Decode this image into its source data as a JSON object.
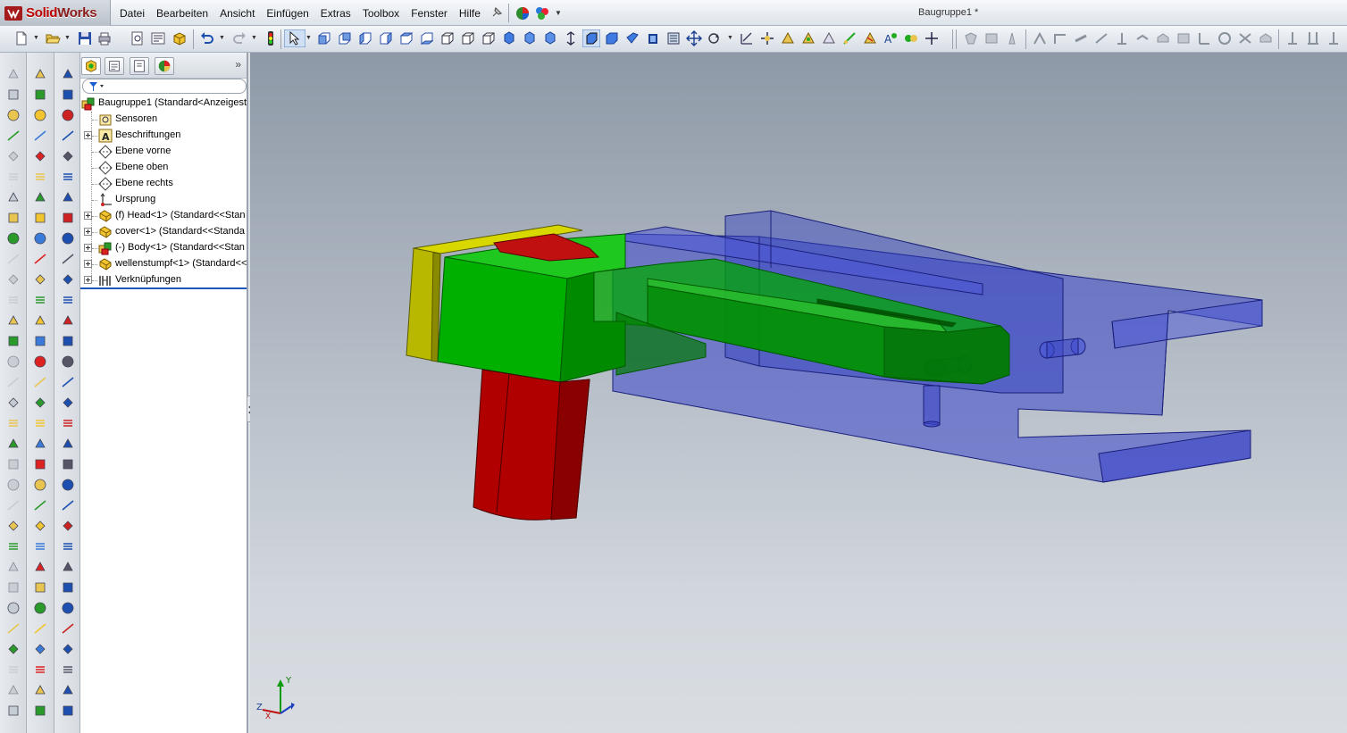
{
  "app": {
    "name_prefix": "Solid",
    "name_suffix": "Works",
    "document_title": "Baugruppe1 *"
  },
  "menu": {
    "items": [
      "Datei",
      "Bearbeiten",
      "Ansicht",
      "Einfügen",
      "Extras",
      "Toolbox",
      "Fenster",
      "Hilfe"
    ]
  },
  "feature_tree": {
    "root": "Baugruppe1  (Standard<Anzeigest",
    "items": [
      {
        "label": "Sensoren",
        "expandable": false,
        "icon": "sensor-icon"
      },
      {
        "label": "Beschriftungen",
        "expandable": true,
        "icon": "annotation-icon"
      },
      {
        "label": "Ebene vorne",
        "expandable": false,
        "icon": "plane-icon"
      },
      {
        "label": "Ebene oben",
        "expandable": false,
        "icon": "plane-icon"
      },
      {
        "label": "Ebene rechts",
        "expandable": false,
        "icon": "plane-icon"
      },
      {
        "label": "Ursprung",
        "expandable": false,
        "icon": "origin-icon"
      },
      {
        "label": "(f) Head<1> (Standard<<Stan",
        "expandable": true,
        "icon": "part-icon"
      },
      {
        "label": "cover<1> (Standard<<Standa",
        "expandable": true,
        "icon": "part-icon"
      },
      {
        "label": "(-) Body<1> (Standard<<Stan",
        "expandable": true,
        "icon": "part-icon"
      },
      {
        "label": "wellenstumpf<1> (Standard<<",
        "expandable": true,
        "icon": "part-icon"
      },
      {
        "label": "Verknüpfungen",
        "expandable": true,
        "icon": "mates-icon"
      }
    ]
  },
  "triad": {
    "x": "X",
    "y": "Y",
    "z": "Z"
  },
  "colors": {
    "head_red": "#c01010",
    "cover_yellow": "#b8b800",
    "body_green": "#00a800",
    "transparent_blue": "#3a45c8"
  }
}
